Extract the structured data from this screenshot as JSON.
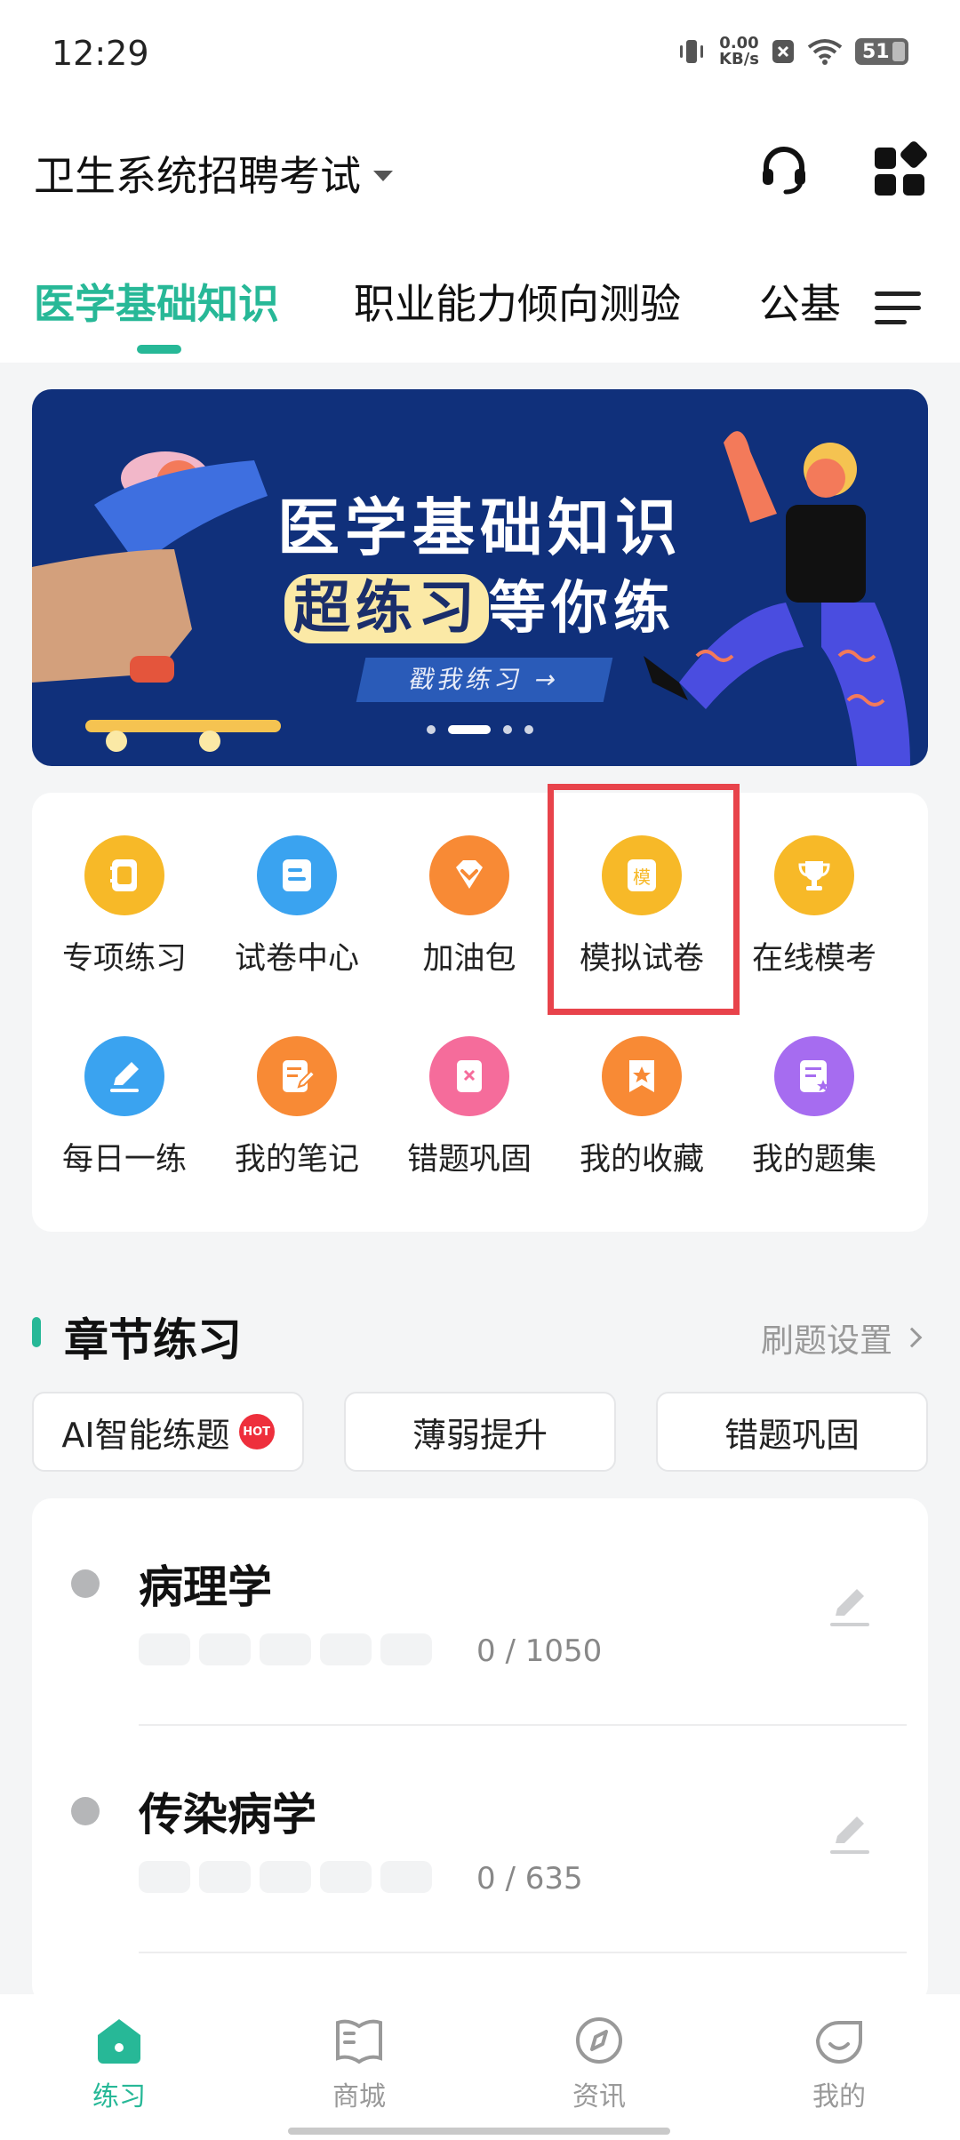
{
  "status_bar": {
    "time": "12:29",
    "net_speed_value": "0.00",
    "net_speed_unit": "KB/s",
    "battery_level": "51",
    "icons": [
      "vibrate-icon",
      "notification-x-icon",
      "wifi-icon",
      "battery-icon"
    ]
  },
  "header": {
    "exam_title": "卫生系统招聘考试",
    "support_icon": "headset-icon",
    "apps_icon": "apps-grid-icon"
  },
  "tabs": {
    "items": [
      "医学基础知识",
      "职业能力倾向测验",
      "公基"
    ],
    "active_index": 0,
    "menu_icon": "menu-lines-icon"
  },
  "banner": {
    "title": "医学基础知识",
    "highlight": "超练习",
    "subtitle_rest": "等你练",
    "cta": "戳我练习 →",
    "carousel_dots": 4,
    "carousel_active": 1
  },
  "grid": {
    "items": [
      {
        "label": "专项练习",
        "icon": "notebook-icon",
        "color": "#f7b928"
      },
      {
        "label": "试卷中心",
        "icon": "document-icon",
        "color": "#3aa3f0"
      },
      {
        "label": "加油包",
        "icon": "diamond-icon",
        "color": "#f88a35"
      },
      {
        "label": "模拟试卷",
        "icon": "mock-paper-icon",
        "glyph": "模",
        "color": "#f7b928"
      },
      {
        "label": "在线模考",
        "icon": "trophy-icon",
        "color": "#f7b928"
      },
      {
        "label": "每日一练",
        "icon": "pencil-icon",
        "color": "#3aa3f0"
      },
      {
        "label": "我的笔记",
        "icon": "note-edit-icon",
        "color": "#f88a35"
      },
      {
        "label": "错题巩固",
        "icon": "wrong-book-icon",
        "color": "#f56c9b"
      },
      {
        "label": "我的收藏",
        "icon": "bookmark-star-icon",
        "color": "#f88a35"
      },
      {
        "label": "我的题集",
        "icon": "question-set-icon",
        "color": "#a66cf0"
      }
    ]
  },
  "chapter": {
    "title": "章节练习",
    "settings_link": "刷题设置",
    "chips": [
      "AI智能练题",
      "薄弱提升",
      "错题巩固"
    ],
    "hot_badge": "HOT",
    "rows": [
      {
        "title": "病理学",
        "count": "0 / 1050"
      },
      {
        "title": "传染病学",
        "count": "0 / 635"
      }
    ]
  },
  "bottom_nav": {
    "items": [
      {
        "label": "练习",
        "icon": "home-icon"
      },
      {
        "label": "商城",
        "icon": "book-open-icon"
      },
      {
        "label": "资讯",
        "icon": "compass-icon"
      },
      {
        "label": "我的",
        "icon": "smile-face-icon"
      }
    ],
    "active_index": 0
  },
  "colors": {
    "accent": "#27b897",
    "banner_bg": "#10307b",
    "highlight_box": "#e8434b"
  }
}
